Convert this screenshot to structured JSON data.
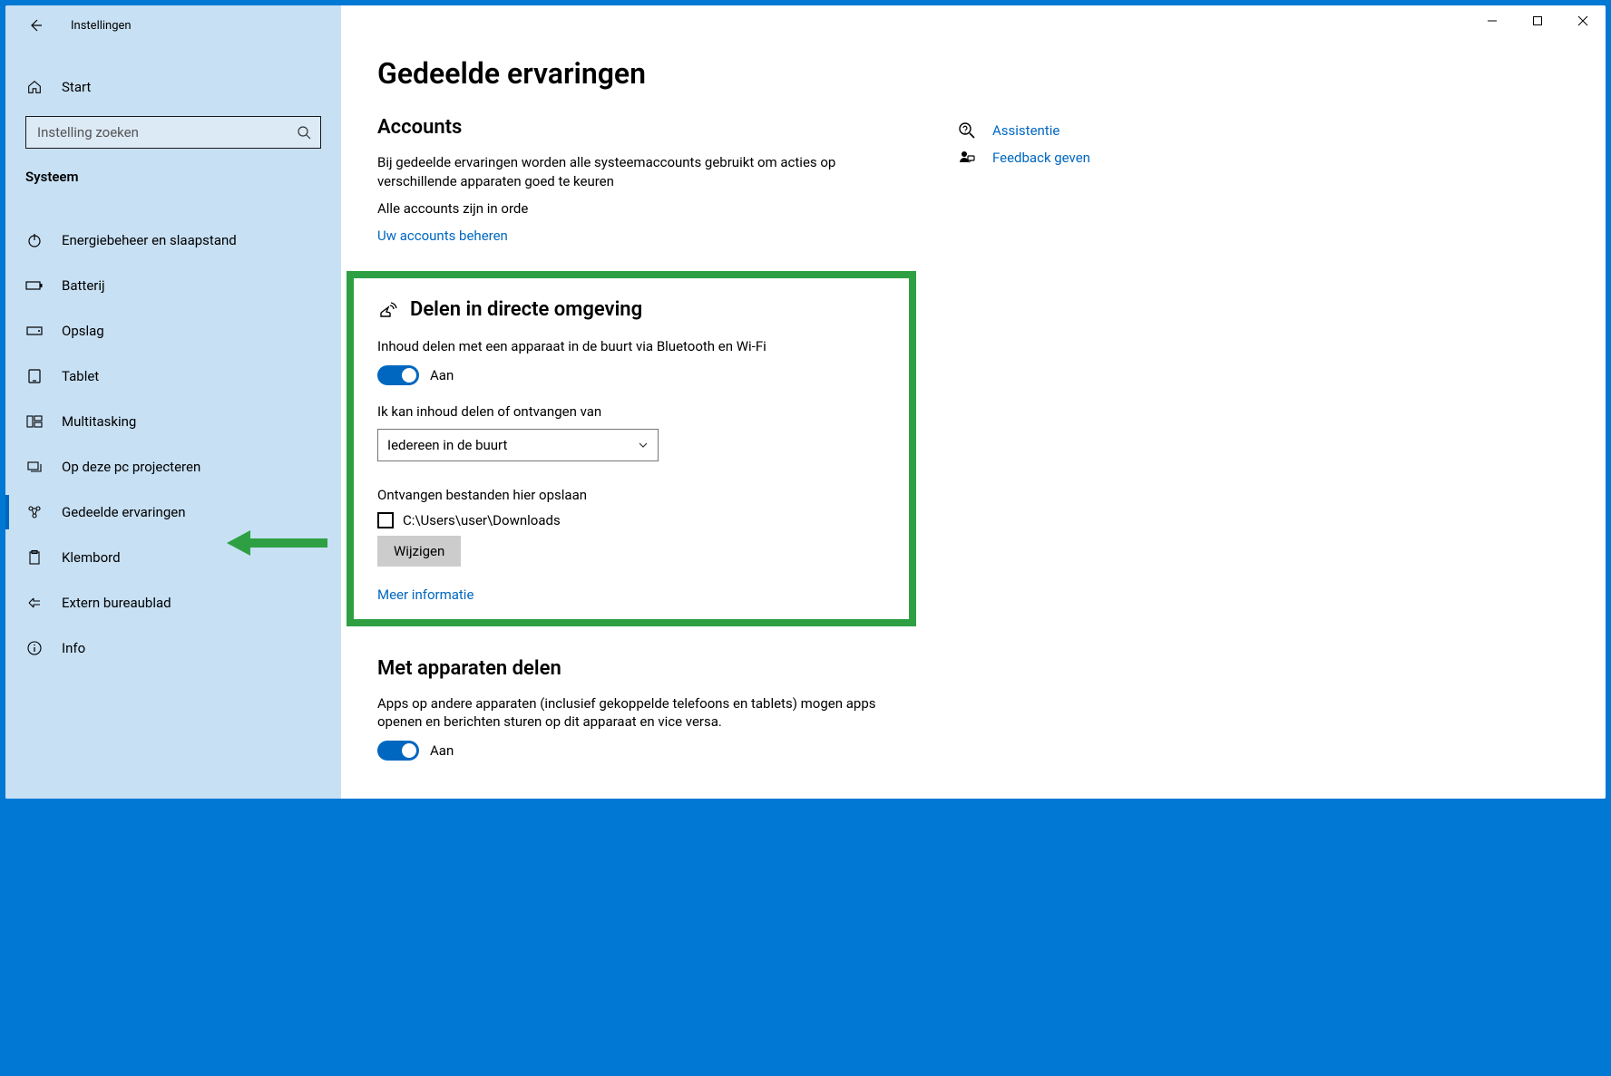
{
  "window": {
    "title": "Instellingen"
  },
  "sidebar": {
    "home_label": "Start",
    "search_placeholder": "Instelling zoeken",
    "category": "Systeem",
    "items": [
      {
        "label": "Energiebeheer en slaapstand",
        "icon": "power"
      },
      {
        "label": "Batterij",
        "icon": "battery"
      },
      {
        "label": "Opslag",
        "icon": "storage"
      },
      {
        "label": "Tablet",
        "icon": "tablet"
      },
      {
        "label": "Multitasking",
        "icon": "multitask"
      },
      {
        "label": "Op deze pc projecteren",
        "icon": "project"
      },
      {
        "label": "Gedeelde ervaringen",
        "icon": "share"
      },
      {
        "label": "Klembord",
        "icon": "clipboard"
      },
      {
        "label": "Extern bureaublad",
        "icon": "remote"
      },
      {
        "label": "Info",
        "icon": "info"
      }
    ]
  },
  "main": {
    "title": "Gedeelde ervaringen",
    "accounts": {
      "heading": "Accounts",
      "desc": "Bij gedeelde ervaringen worden alle systeemaccounts gebruikt om acties op verschillende apparaten goed te keuren",
      "status": "Alle accounts zijn in orde",
      "manage_link": "Uw accounts beheren"
    },
    "nearby": {
      "heading": "Delen in directe omgeving",
      "desc": "Inhoud delen met een apparaat in de buurt via Bluetooth en Wi-Fi",
      "toggle_state": "Aan",
      "receive_from_label": "Ik kan inhoud delen of ontvangen van",
      "receive_from_value": "Iedereen in de buurt",
      "save_to_label": "Ontvangen bestanden hier opslaan",
      "save_path": "C:\\Users\\user\\Downloads",
      "change_btn": "Wijzigen",
      "more_info": "Meer informatie"
    },
    "across_devices": {
      "heading": "Met apparaten delen",
      "desc": "Apps op andere apparaten (inclusief gekoppelde telefoons en tablets) mogen apps openen en berichten sturen op dit apparaat en vice versa.",
      "toggle_state": "Aan"
    }
  },
  "side": {
    "help": "Assistentie",
    "feedback": "Feedback geven"
  },
  "colors": {
    "accent": "#0067c0",
    "highlight_border": "#2ea043",
    "sidebar_bg": "#c7e0f4"
  }
}
